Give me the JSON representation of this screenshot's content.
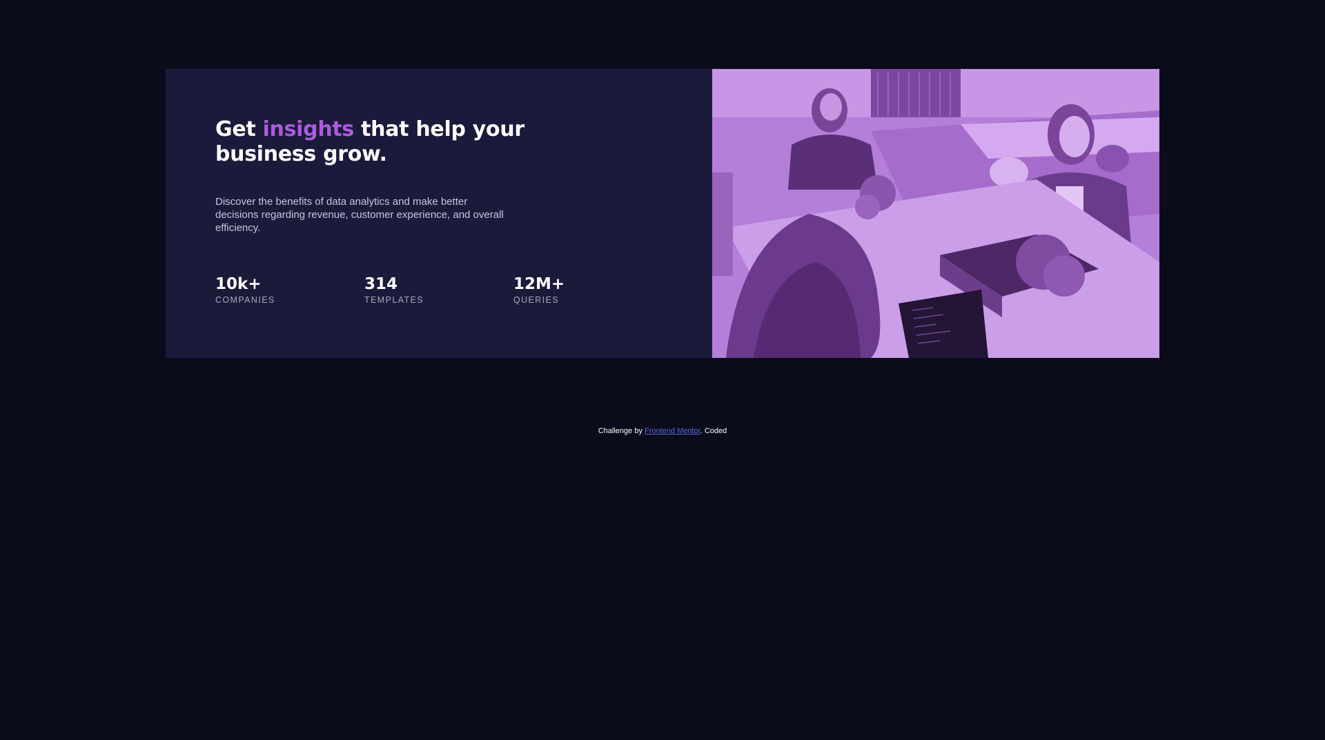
{
  "card": {
    "headline_start": "Get ",
    "headline_accent": "insights",
    "headline_end": " that help your business grow.",
    "description": "Discover the benefits of data analytics and make better decisions regarding revenue, customer experience, and overall efficiency.",
    "stats": [
      {
        "value": "10k+",
        "label": "Companies"
      },
      {
        "value": "314",
        "label": "Templates"
      },
      {
        "value": "12M+",
        "label": "Queries"
      }
    ]
  },
  "footer": {
    "prefix": "Challenge by ",
    "link_text": "Frontend Mentor",
    "suffix": ". Coded"
  },
  "colors": {
    "page_background": "#0a0c1c",
    "card_background": "#1c1a3a",
    "accent": "#aa5cdb",
    "image_tint": "#a86ad0",
    "link": "#5b66d6"
  }
}
